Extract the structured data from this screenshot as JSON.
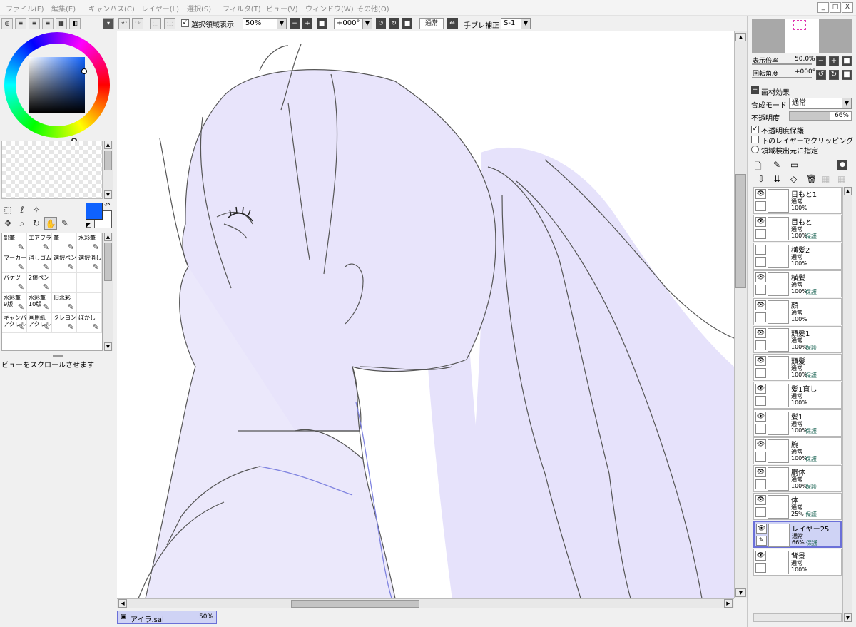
{
  "menu": [
    "ファイル(F)",
    "編集(E)",
    "キャンバス(C)",
    "レイヤー(L)",
    "選択(S)",
    "フィルタ(T)",
    "ビュー(V)",
    "ウィンドウ(W)",
    "その他(O)"
  ],
  "window_controls": {
    "minimize": "_",
    "restore": "□",
    "close": "X"
  },
  "toolbar": {
    "show_selection_label": "選択領域表示",
    "show_selection_checked": true,
    "zoom": "50%",
    "rotation": "+000°",
    "blend": "通常",
    "stabilizer_label": "手ブレ補正",
    "stabilizer_value": "S-1"
  },
  "left_panel": {
    "colors": {
      "primary": "#0f62fe",
      "secondary": "#ffffff"
    },
    "brushes": [
      {
        "label": "鉛筆",
        "icon": "pencil-icon"
      },
      {
        "label": "エアブラシ",
        "icon": "airbrush-icon"
      },
      {
        "label": "筆",
        "icon": "brush-icon"
      },
      {
        "label": "水彩筆",
        "icon": "watercolor-icon"
      },
      {
        "label": "マーカー",
        "icon": "marker-icon"
      },
      {
        "label": "消しゴム",
        "icon": "eraser-icon"
      },
      {
        "label": "選択ペン",
        "icon": "select-pen-icon"
      },
      {
        "label": "選択消し",
        "icon": "select-erase-icon"
      },
      {
        "label": "バケツ",
        "icon": "bucket-icon"
      },
      {
        "label": "2値ペン",
        "icon": "binary-pen-icon"
      },
      {
        "label": "",
        "icon": ""
      },
      {
        "label": "",
        "icon": ""
      },
      {
        "label": "水彩筆\n9版",
        "icon": "watercolor-icon"
      },
      {
        "label": "水彩筆\n10版",
        "icon": "watercolor-icon"
      },
      {
        "label": "旧水彩",
        "icon": "old-watercolor-icon"
      },
      {
        "label": "",
        "icon": ""
      },
      {
        "label": "キャンバス\nアクリル",
        "icon": "acrylic-icon"
      },
      {
        "label": "画用紙\nアクリル",
        "icon": "acrylic-icon"
      },
      {
        "label": "クレヨン",
        "icon": "crayon-icon"
      },
      {
        "label": "ぼかし",
        "icon": "blur-icon"
      }
    ],
    "status": "ビューをスクロールさせます"
  },
  "document_tab": {
    "name": "アイラ.sai",
    "zoom": "50%"
  },
  "navigator": {
    "zoom_label": "表示倍率",
    "zoom_value": "50.0%",
    "rotation_label": "回転角度",
    "rotation_value": "+000°"
  },
  "layer_props": {
    "texture_label": "画材効果",
    "blend_label": "合成モード",
    "blend_value": "通常",
    "opacity_label": "不透明度",
    "opacity_value": "66%",
    "opacity_fraction": 0.66,
    "preserve_opacity": {
      "label": "不透明度保護",
      "checked": true
    },
    "clip": {
      "label": "下のレイヤーでクリッピング",
      "checked": false
    },
    "selection_source": {
      "label": "領域検出元に指定",
      "checked": false
    }
  },
  "layers": [
    {
      "name": "目もと1",
      "mode": "通常",
      "opacity": "100%",
      "protect": "",
      "visible": true,
      "selected": false
    },
    {
      "name": "目もと",
      "mode": "通常",
      "opacity": "100%",
      "protect": "保護",
      "visible": true,
      "selected": false
    },
    {
      "name": "横髪2",
      "mode": "通常",
      "opacity": "100%",
      "protect": "",
      "visible": false,
      "selected": false
    },
    {
      "name": "横髪",
      "mode": "通常",
      "opacity": "100%",
      "protect": "保護",
      "visible": true,
      "selected": false
    },
    {
      "name": "顔",
      "mode": "通常",
      "opacity": "100%",
      "protect": "",
      "visible": true,
      "selected": false
    },
    {
      "name": "頭髪1",
      "mode": "通常",
      "opacity": "100%",
      "protect": "保護",
      "visible": true,
      "selected": false
    },
    {
      "name": "頭髪",
      "mode": "通常",
      "opacity": "100%",
      "protect": "保護",
      "visible": true,
      "selected": false
    },
    {
      "name": "髪1直し",
      "mode": "通常",
      "opacity": "100%",
      "protect": "",
      "visible": true,
      "selected": false
    },
    {
      "name": "髪1",
      "mode": "通常",
      "opacity": "100%",
      "protect": "保護",
      "visible": true,
      "selected": false
    },
    {
      "name": "腕",
      "mode": "通常",
      "opacity": "100%",
      "protect": "保護",
      "visible": true,
      "selected": false
    },
    {
      "name": "胴体",
      "mode": "通常",
      "opacity": "100%",
      "protect": "保護",
      "visible": true,
      "selected": false
    },
    {
      "name": "体",
      "mode": "通常",
      "opacity": "25%",
      "protect": "保護",
      "visible": true,
      "selected": false
    },
    {
      "name": "レイヤー25",
      "mode": "通常",
      "opacity": "66%",
      "protect": "保護",
      "visible": true,
      "selected": true
    },
    {
      "name": "背景",
      "mode": "通常",
      "opacity": "100%",
      "protect": "",
      "visible": true,
      "selected": false
    }
  ]
}
